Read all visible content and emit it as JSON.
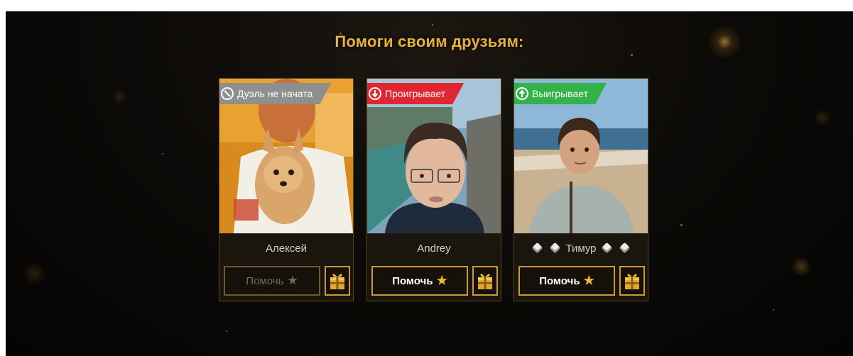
{
  "title": "Помоги своим друзьям:",
  "colors": {
    "accent": "#e8b23a",
    "status_grey": "#8f8f8f",
    "status_red": "#e0262f",
    "status_green": "#33b24a"
  },
  "friends": [
    {
      "name": "Алексей",
      "status": "Дуэль не начата",
      "status_icon": "ban-icon",
      "help_label": "Помочь",
      "help_enabled": false
    },
    {
      "name": "Andrey",
      "status": "Проигрывает",
      "status_icon": "arrow-down-circle-icon",
      "help_label": "Помочь",
      "help_enabled": true
    },
    {
      "name": "Тимур",
      "status": "Выигрывает",
      "status_icon": "arrow-up-circle-icon",
      "help_label": "Помочь",
      "help_enabled": true
    }
  ]
}
